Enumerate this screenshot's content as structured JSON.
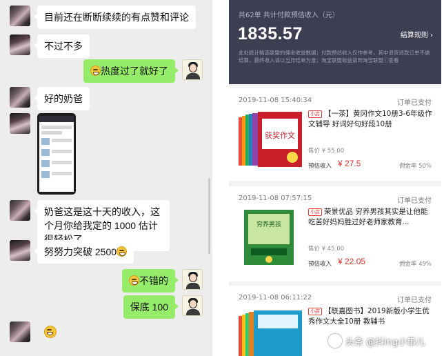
{
  "chat": {
    "messages": [
      {
        "side": "in",
        "text": "目前还在断断续续的有点赞和评论"
      },
      {
        "side": "in",
        "text": "不过不多"
      },
      {
        "side": "out",
        "text": "热度过了就好了"
      },
      {
        "side": "in",
        "text": "好的奶爸"
      },
      {
        "side": "in",
        "type": "image",
        "text": ""
      },
      {
        "side": "in",
        "text": "奶爸这是这十天的收入，这个月你给我定的 1000 估计很轻松了"
      },
      {
        "side": "in",
        "text": "努努力突破 2500"
      },
      {
        "side": "out",
        "text": "不错的"
      },
      {
        "side": "out",
        "text": "保底 100"
      },
      {
        "side": "in",
        "type": "emoji",
        "text": ""
      }
    ]
  },
  "earnings": {
    "summary_label": "共62单 共计付款预估收入（元）",
    "total": "1835.57",
    "rules_label": "结算规则 ›",
    "note": "此处统计精选联盟的佣金收益数据；付款预估收入仅作参考，其中退货退款订单不做结算，最终收入请以当月结单为准；淘宝联盟收益请到淘宝联盟ⓘ查看",
    "orders": [
      {
        "time": "2019-11-08 15:40:34",
        "status": "订单已支付",
        "tag": "小店",
        "title": "【一茶】黄冈作文10册3-6年级作文辅导 好词好句好段10册",
        "price": "售价 ¥ 55.00",
        "est_label": "预估收入",
        "est_value": "¥ 27.5",
        "commission": "佣金率 50%",
        "book_color": "#c8202a",
        "cover_text": "获奖作文"
      },
      {
        "time": "2019-11-08 07:57:15",
        "status": "订单已支付",
        "tag": "小店",
        "title": "荣景优品 穷养男孩其实是让他能吃苦好妈妈胜过好老师家教育...",
        "price": "售价 ¥ 45.00",
        "est_label": "预估收入",
        "est_value": "¥ 22.05",
        "commission": "佣金率 49%",
        "book_color": "#2e8b3a",
        "cover_text": "穷养男孩"
      },
      {
        "time": "2019-11-08 06:11:22",
        "status": "订单已支付",
        "tag": "小店",
        "title": "【联嘉图书】2019新版小学生优秀作文大全10册 教辅书",
        "price": "",
        "est_label": "",
        "est_value": "",
        "commission": "",
        "book_color": "#1f9bcc",
        "cover_text": ""
      }
    ]
  },
  "watermark": {
    "text": "头条 @抖ing小事儿"
  }
}
